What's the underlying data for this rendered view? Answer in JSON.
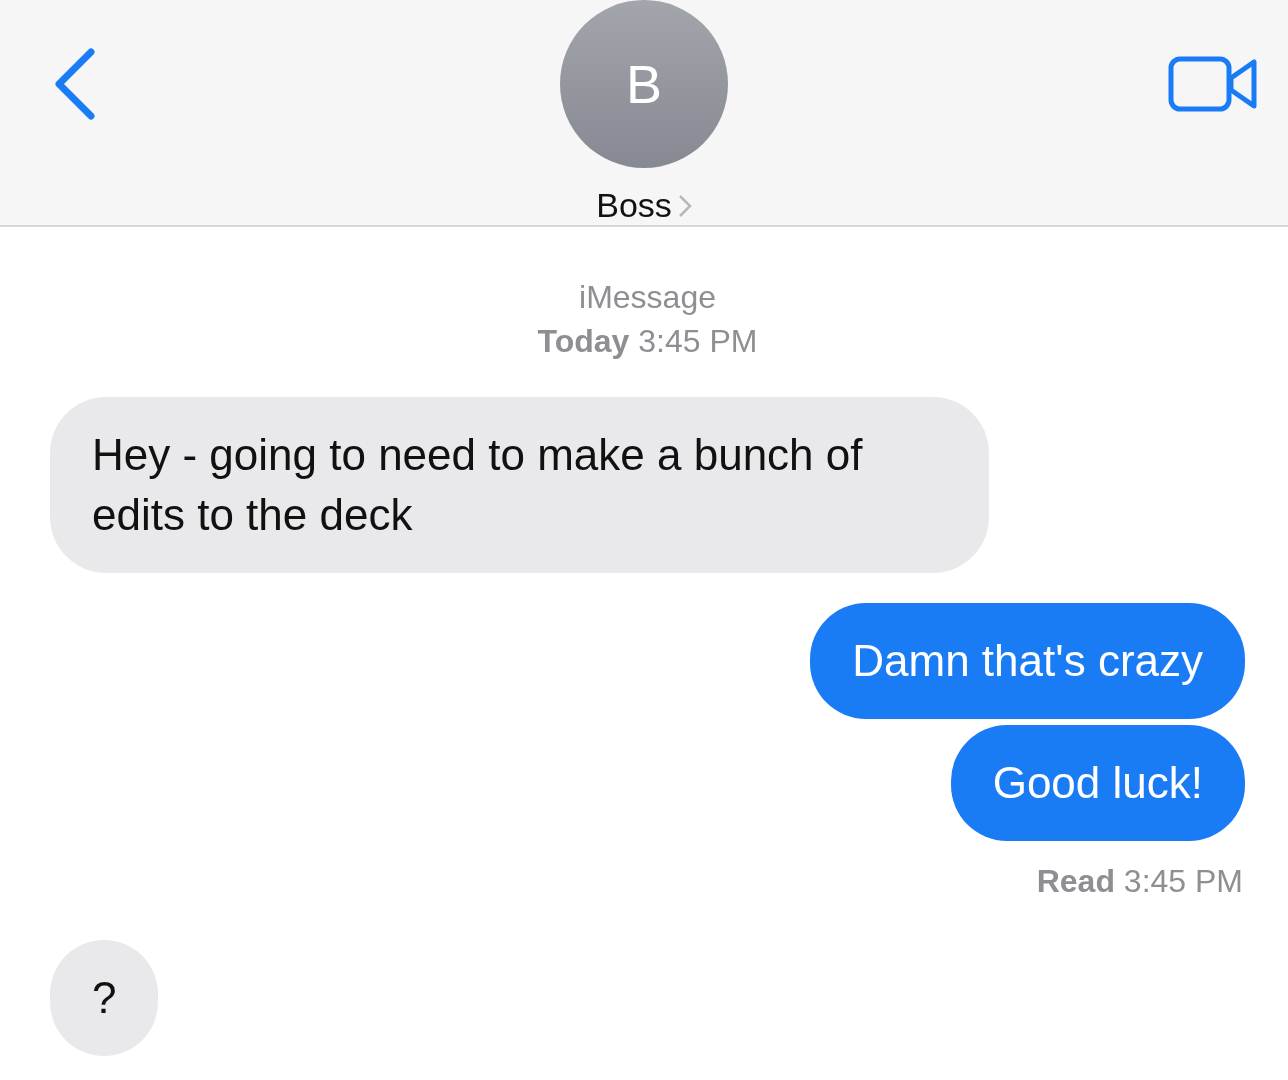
{
  "header": {
    "initial": "B",
    "name": "Boss"
  },
  "thread": [
    {
      "kind": "timestamp",
      "service": "iMessage",
      "day": "Today",
      "time": "3:45 PM"
    },
    {
      "kind": "received",
      "text": "Hey - going to need to make a bunch of edits to the deck"
    },
    {
      "kind": "sent",
      "text": "Damn that's crazy"
    },
    {
      "kind": "sent",
      "text": "Good luck!"
    },
    {
      "kind": "receipt",
      "status": "Read",
      "time": "3:45 PM"
    },
    {
      "kind": "received",
      "text": "?"
    }
  ]
}
